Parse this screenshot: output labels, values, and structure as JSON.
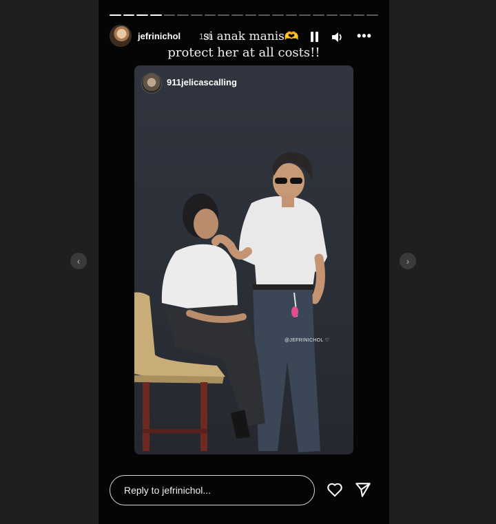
{
  "story": {
    "progress": {
      "total_segments": 20,
      "completed_segments": 4
    },
    "username": "jefrinichol",
    "time_ago": "19h",
    "caption_line1": "si anak manis🫶",
    "caption_line2": "protect her at all costs!!",
    "controls": {
      "pause_icon": "pause-icon",
      "volume_icon": "volume-icon",
      "more_icon": "more-icon",
      "more_glyph": "•••"
    }
  },
  "media": {
    "repost_username": "911jelicascalling",
    "watermark": "@JEFRINICHOL ♡"
  },
  "navigation": {
    "prev_glyph": "‹",
    "next_glyph": "›"
  },
  "footer": {
    "reply_placeholder": "Reply to jefrinichol...",
    "like_icon": "heart-icon",
    "share_icon": "send-icon"
  }
}
